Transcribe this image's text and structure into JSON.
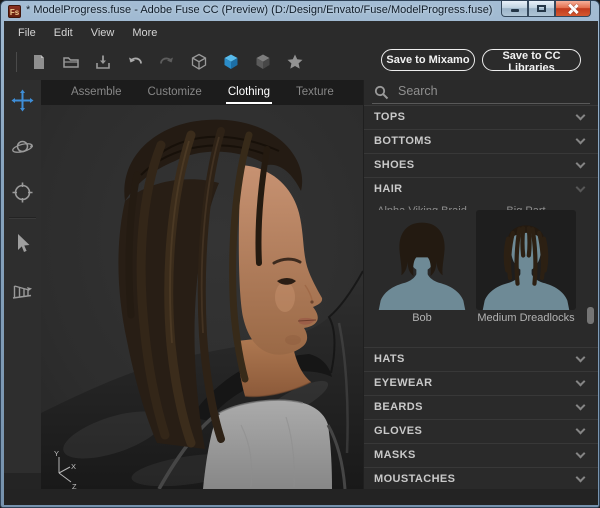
{
  "window": {
    "title": "* ModelProgress.fuse - Adobe Fuse CC (Preview) (D:/Design/Envato/Fuse/ModelProgress.fuse)",
    "app_icon_text": "Fs"
  },
  "menu": {
    "items": [
      "File",
      "Edit",
      "View",
      "More"
    ]
  },
  "toolbar": {
    "icons": [
      "new-file",
      "open-folder",
      "save",
      "undo",
      "redo",
      "cube-wireframe",
      "cube-solid-active",
      "cube-shaded",
      "favorite-star"
    ],
    "save_to_mixamo_label": "Save to Mixamo",
    "save_to_cc_libraries_label": "Save to CC Libraries"
  },
  "left_tools": [
    "move",
    "orbit",
    "target",
    "select",
    "perspective"
  ],
  "tabs": {
    "items": [
      {
        "label": "Assemble",
        "active": false
      },
      {
        "label": "Customize",
        "active": false
      },
      {
        "label": "Clothing",
        "active": true
      },
      {
        "label": "Texture",
        "active": false
      }
    ]
  },
  "viewport": {
    "axis": {
      "x": "X",
      "y": "Y",
      "z": "Z"
    }
  },
  "panel": {
    "search_placeholder": "Search",
    "sections_top": [
      {
        "label": "TOPS"
      },
      {
        "label": "BOTTOMS"
      },
      {
        "label": "SHOES"
      }
    ],
    "hair_section": {
      "label": "HAIR",
      "clipped_labels": [
        "Alpha Viking Braid",
        "Big Part"
      ],
      "items": [
        {
          "label": "Bob",
          "selected": false
        },
        {
          "label": "Medium Dreadlocks",
          "selected": true
        }
      ]
    },
    "sections_bottom": [
      {
        "label": "HATS"
      },
      {
        "label": "EYEWEAR"
      },
      {
        "label": "BEARDS"
      },
      {
        "label": "GLOVES"
      },
      {
        "label": "MASKS"
      },
      {
        "label": "MOUSTACHES"
      }
    ]
  },
  "colors": {
    "accent_blue": "#2f93d0",
    "silhouette": "#6e8a96",
    "selection_bg": "#1e1e1e",
    "tab_active": "#ffffff",
    "close_button": "#c13a1d",
    "panel_bg": "#2a2a2a"
  }
}
